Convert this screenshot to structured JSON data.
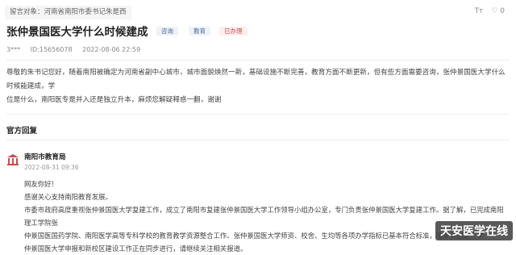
{
  "breadcrumb": "留言对象：河南省南阳市委书记朱是西",
  "toolbar": {
    "font_icon_label": "Tт",
    "like_icon": "♡",
    "like_count": "0"
  },
  "title": "张仲景国医大学什么时候建成",
  "tags": [
    {
      "label": "咨询",
      "bg": "#eef2f8",
      "color": "#4a6a9a"
    },
    {
      "label": "教育",
      "bg": "#eef2f8",
      "color": "#4a6a9a"
    },
    {
      "label": "已办理",
      "bg": "#fdeeee",
      "color": "#d24b4b"
    }
  ],
  "meta": {
    "user": "3***",
    "id": "ID:15656078",
    "datetime": "2022-08-06 22:59"
  },
  "message_lines": [
    "尊敬的朱书记您好，随着南阳被确定为河南省副中心城市，城市面貌焕然一新，基础设施不断完善，教育方面不断更新，但有些方面需要咨询，张仲景国医大学什么时候能建成，学",
    "位是什么，南阳医专是并入还是独立升本，麻烦您解疑释惑一翻，谢谢"
  ],
  "official_reply": {
    "section_title": "官方回复",
    "org_name": "南阳市教育局",
    "date": "2022-08-31 09:36",
    "lines": [
      "网友你好！",
      "感谢关心支持南阳教育发展。",
      "市委市政府高度重视张仲景国医大学复建工作，成立了南阳市复建张仲景国医大学工作领导小组办公室，专门负责张仲景国医大学复建工作。据了解，已完成南阳理工学院张",
      "仲景国医国药学院、南阳医学高等专科学校的教育教学资源整合工作。张仲景国医大学师资、校舍、生均等各项办学指标已基本符合标准，张仲景国医大学",
      "仲景国医大学申报和新校区建设工作正在同步进行，请继续关注相关报道。"
    ]
  },
  "watermark": "天安医学在线"
}
